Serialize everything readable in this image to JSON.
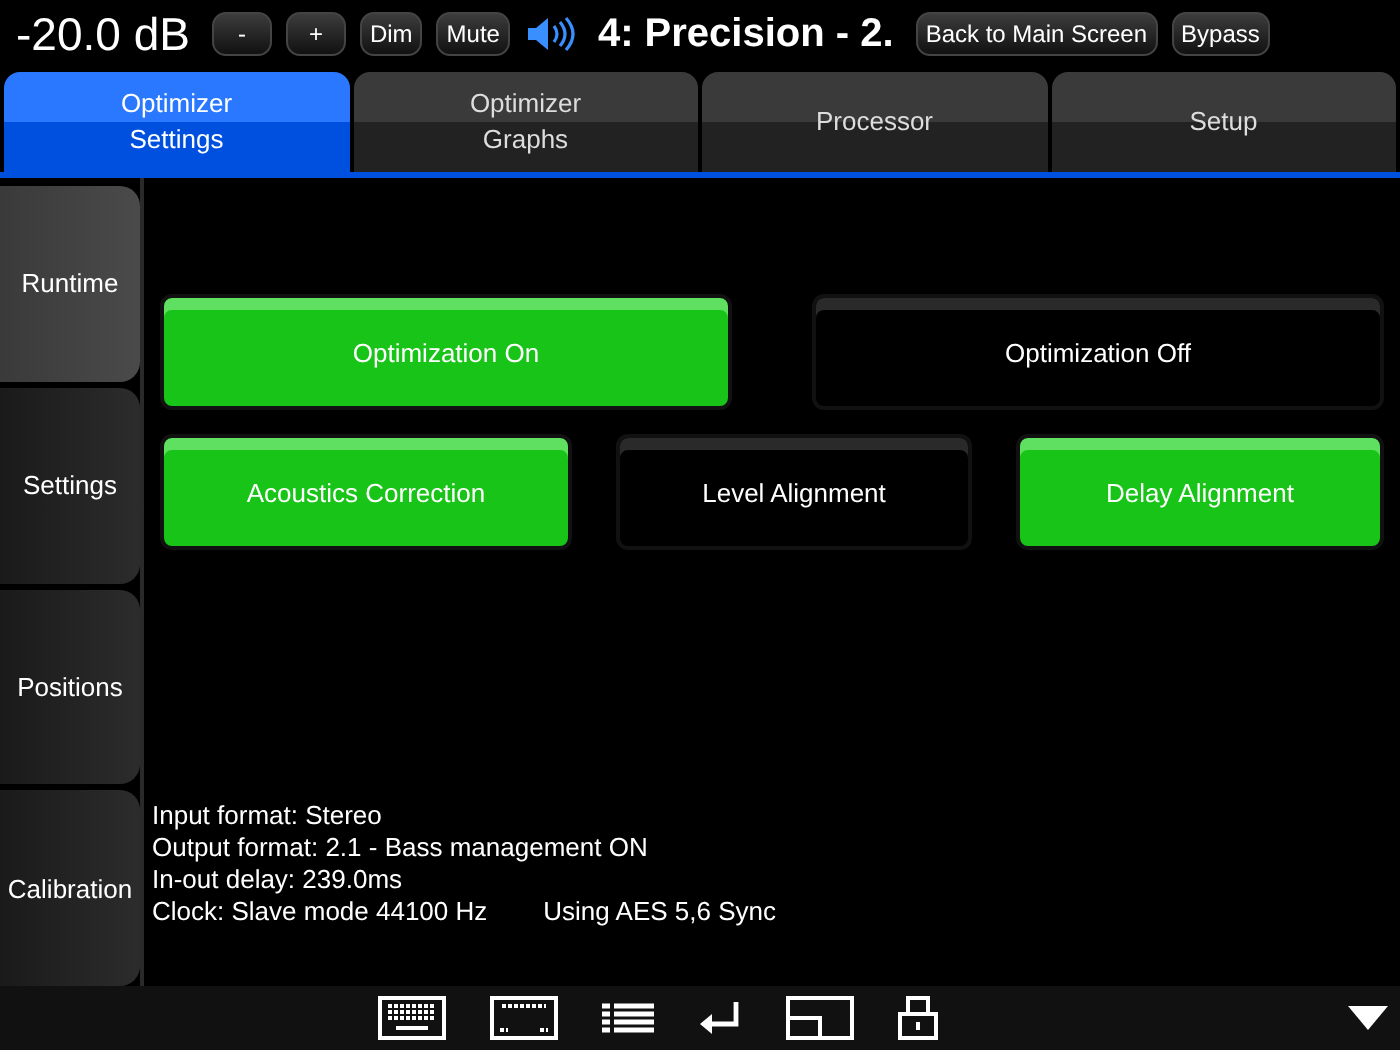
{
  "header": {
    "volume": "-20.0 dB",
    "buttons": [
      "-",
      "+",
      "Dim",
      "Mute"
    ],
    "preset": "4: Precision - 2.",
    "back_button": "Back to Main Screen",
    "bypass_button": "Bypass"
  },
  "tabs": [
    {
      "label": "Optimizer\nSettings",
      "selected": true
    },
    {
      "label": "Optimizer\nGraphs",
      "selected": false
    },
    {
      "label": "Processor",
      "selected": false
    },
    {
      "label": "Setup",
      "selected": false
    }
  ],
  "sidebar": {
    "items": [
      {
        "label": "Runtime",
        "selected": true
      },
      {
        "label": "Settings",
        "selected": false
      },
      {
        "label": "Positions",
        "selected": false
      },
      {
        "label": "Calibration",
        "selected": false
      }
    ]
  },
  "toggle_rows": [
    [
      {
        "label": "Optimization On",
        "on": true
      },
      {
        "label": "Optimization Off",
        "on": false
      }
    ],
    [
      {
        "label": "Acoustics Correction",
        "on": true
      },
      {
        "label": "Level Alignment",
        "on": false
      },
      {
        "label": "Delay Alignment",
        "on": true
      }
    ]
  ],
  "status_lines": [
    [
      "Input format: Stereo"
    ],
    [
      "Output format: 2.1 - Bass management ON"
    ],
    [
      "In-out delay: 239.0ms"
    ],
    [
      "Clock: Slave mode 44100 Hz",
      "Using AES 5,6 Sync"
    ]
  ]
}
